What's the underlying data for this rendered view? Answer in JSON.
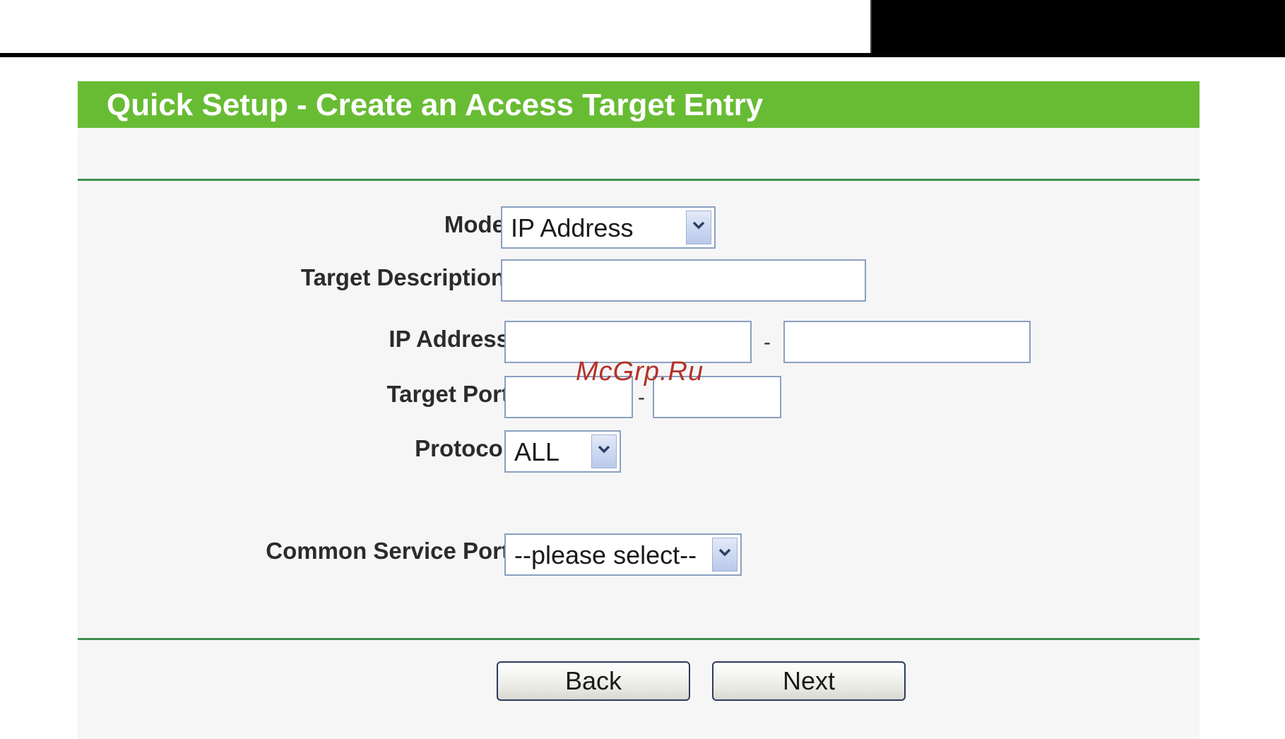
{
  "header": {
    "title": "Quick Setup - Create an Access Target Entry"
  },
  "form": {
    "mode": {
      "label": "Mode:",
      "value": "IP Address"
    },
    "target_description": {
      "label": "Target Description:",
      "value": ""
    },
    "ip_address": {
      "label": "IP Address:",
      "start": "",
      "end": "",
      "separator": "-"
    },
    "target_port": {
      "label": "Target Port:",
      "start": "",
      "end": "",
      "separator": "-"
    },
    "protocol": {
      "label": "Protocol:",
      "value": "ALL"
    },
    "common_service_port": {
      "label": "Common Service Port:",
      "value": "--please select--"
    }
  },
  "watermark": "McGrp.Ru",
  "buttons": {
    "back": "Back",
    "next": "Next"
  },
  "colors": {
    "header": "#68bc34",
    "separator": "#3f8f4f",
    "panel": "#f6f6f6"
  },
  "icons": {
    "dropdown": "chevron-down-icon"
  }
}
